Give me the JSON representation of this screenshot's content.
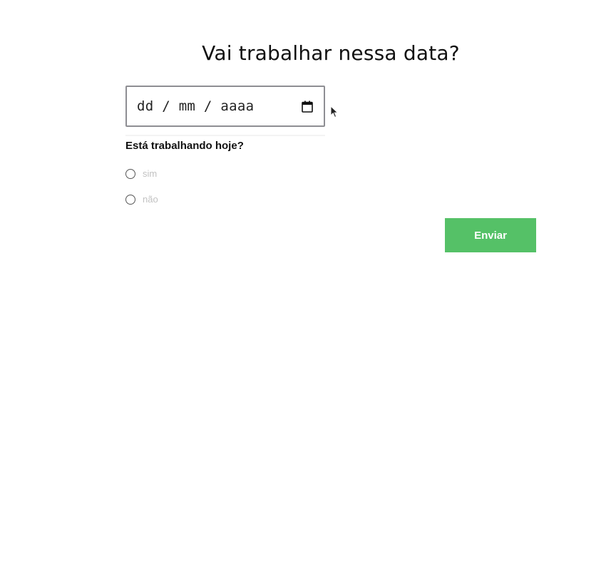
{
  "form": {
    "title": "Vai trabalhar nessa data?",
    "date_input": {
      "placeholder": "dd / mm / aaaa",
      "icon": "calendar-icon"
    },
    "question": "Está trabalhando hoje?",
    "options": [
      {
        "label": "sim",
        "selected": false
      },
      {
        "label": "não",
        "selected": false
      }
    ],
    "submit_label": "Enviar"
  },
  "colors": {
    "submit_button": "#55c167",
    "option_text": "#c2c2c2",
    "input_border": "#8e8e93"
  }
}
